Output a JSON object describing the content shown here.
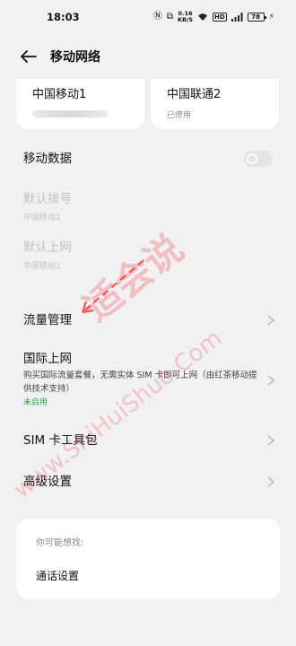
{
  "status": {
    "time": "18:03",
    "speed_value": "0.16",
    "speed_unit": "KB/S",
    "hd_label": "HD",
    "battery": "78"
  },
  "header": {
    "title": "移动网络"
  },
  "sims": [
    {
      "name": "中国移动1"
    },
    {
      "name": "中国联通2",
      "status": "已停用"
    }
  ],
  "mobile_data": {
    "label": "移动数据",
    "enabled": false
  },
  "default_calls": {
    "label": "默认拨号",
    "value": "中国移动1"
  },
  "default_internet": {
    "label": "默认上网",
    "value": "中国移动1"
  },
  "data_usage": {
    "label": "流量管理"
  },
  "intl_roaming": {
    "label": "国际上网",
    "desc": "购买国际流量套餐，无需实体 SIM 卡即可上网（由红茶移动提供技术支持）",
    "status": "未启用"
  },
  "sim_toolkit": {
    "label": "SIM 卡工具包"
  },
  "advanced": {
    "label": "高级设置"
  },
  "suggestions": {
    "title": "你可能想找:",
    "items": [
      "通话设置"
    ]
  },
  "watermark": {
    "cn": "适会说",
    "en": "www.ShiHuiShuo.Com",
    "color": "#f03c3c"
  }
}
